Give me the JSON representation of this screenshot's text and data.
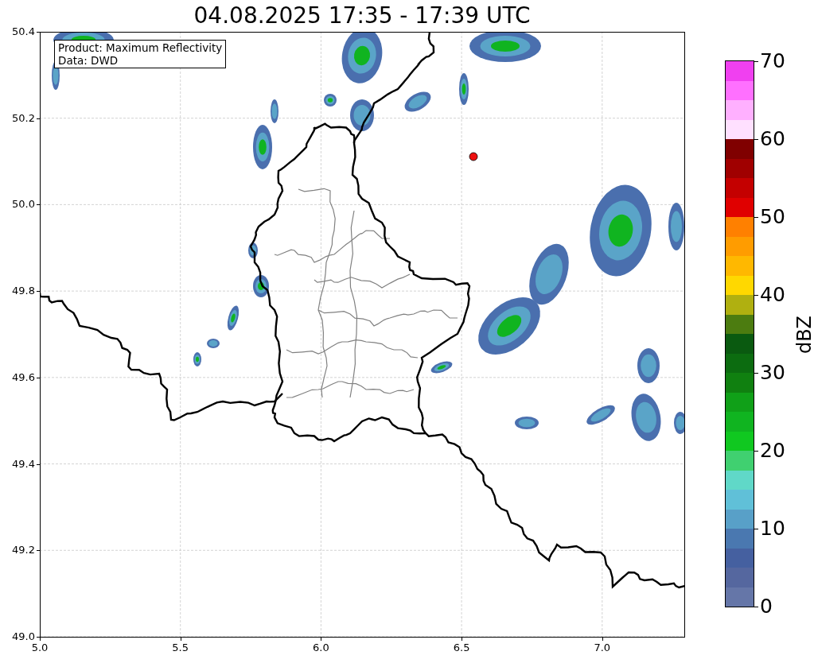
{
  "title": "04.08.2025 17:35 - 17:39 UTC",
  "map": {
    "info_box": [
      "Product: Maximum Reflectivity",
      "Data: DWD"
    ],
    "x_ticks": [
      "5.0",
      "5.5",
      "6.0",
      "6.5",
      "7.0"
    ],
    "y_ticks": [
      "50.4",
      "50.2",
      "50.0",
      "49.8",
      "49.6",
      "49.4",
      "49.2",
      "49.0"
    ]
  },
  "colorbar": {
    "label": "dBZ",
    "ticks": [
      "70",
      "60",
      "50",
      "40",
      "30",
      "20",
      "10",
      "0"
    ],
    "segments": [
      {
        "color": "#6576a8"
      },
      {
        "color": "#55679f"
      },
      {
        "color": "#4560a0"
      },
      {
        "color": "#4a78b0"
      },
      {
        "color": "#58a0c8"
      },
      {
        "color": "#60c0d8"
      },
      {
        "color": "#60d8c8"
      },
      {
        "color": "#40d070"
      },
      {
        "color": "#10c820"
      },
      {
        "color": "#10b420"
      },
      {
        "color": "#10a018"
      },
      {
        "color": "#108010"
      },
      {
        "color": "#0c6c10"
      },
      {
        "color": "#0a5a10"
      },
      {
        "color": "#4c7c10"
      },
      {
        "color": "#b0b010"
      },
      {
        "color": "#ffd800"
      },
      {
        "color": "#ffb800"
      },
      {
        "color": "#ff9c00"
      },
      {
        "color": "#ff8000"
      },
      {
        "color": "#e00000"
      },
      {
        "color": "#c40000"
      },
      {
        "color": "#a00000"
      },
      {
        "color": "#800000"
      },
      {
        "color": "#ffe0ff"
      },
      {
        "color": "#ffb0ff"
      },
      {
        "color": "#ff70ff"
      },
      {
        "color": "#f040f0"
      }
    ]
  }
}
